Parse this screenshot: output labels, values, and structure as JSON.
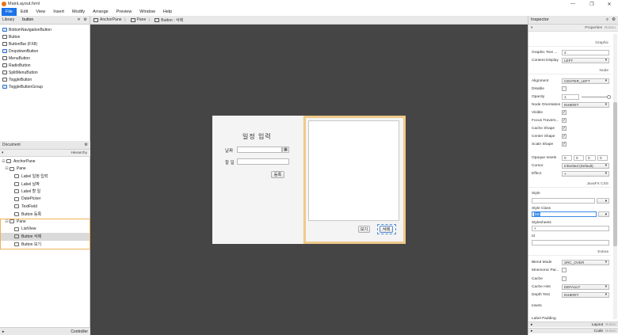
{
  "window": {
    "title": "MainLayout.fxml",
    "minimize": "—",
    "maximize": "❐",
    "close": "✕"
  },
  "menu": [
    "File",
    "Edit",
    "View",
    "Insert",
    "Modify",
    "Arrange",
    "Preview",
    "Window",
    "Help"
  ],
  "library": {
    "title": "Library",
    "search_value": "button",
    "items": [
      "BottomNavigationButton",
      "Button",
      "ButtonBar (FX8)",
      "DropdownButton",
      "MenuButton",
      "RadioButton",
      "SplitMenuButton",
      "ToggleButton",
      "ToggleButtonGroup"
    ]
  },
  "document": {
    "title": "Document",
    "hierarchy_label": "Hierarchy",
    "tree": [
      {
        "label": "AnchorPane",
        "indent": 0,
        "toggle": "⊟"
      },
      {
        "label": "Pane",
        "indent": 1,
        "toggle": "⊟"
      },
      {
        "label": "Label  일정 입력",
        "indent": 2,
        "toggle": ""
      },
      {
        "label": "Label  날짜",
        "indent": 2,
        "toggle": ""
      },
      {
        "label": "Label  할 일",
        "indent": 2,
        "toggle": ""
      },
      {
        "label": "DatePicker",
        "indent": 2,
        "toggle": ""
      },
      {
        "label": "TextField",
        "indent": 2,
        "toggle": ""
      },
      {
        "label": "Button  등록",
        "indent": 2,
        "toggle": ""
      },
      {
        "label": "Pane",
        "indent": 1,
        "toggle": "⊟"
      },
      {
        "label": "ListView",
        "indent": 2,
        "toggle": ""
      },
      {
        "label": "Button  삭제",
        "indent": 2,
        "toggle": ""
      },
      {
        "label": "Button  보기",
        "indent": 2,
        "toggle": ""
      }
    ],
    "controller_label": "Controller"
  },
  "breadcrumb": [
    "AnchorPane",
    "Pane",
    "Button : 삭제"
  ],
  "form": {
    "title": "일정 입력",
    "date_label": "날짜",
    "todo_label": "할 일",
    "register_button": "등록",
    "view_button": "보기",
    "delete_button": "삭제",
    "date_icon": "▦"
  },
  "inspector": {
    "title": "Inspector",
    "properties_label": "Properties",
    "properties_sub": "Button",
    "graphic_section": "Graphic",
    "graphic_text_gap_label": "Graphic Text ...",
    "graphic_text_gap_value": "4",
    "content_display_label": "Content Display",
    "content_display_value": "LEFT",
    "node_section": "Node",
    "alignment_label": "Alignment",
    "alignment_value": "CENTER_LEFT",
    "disable_label": "Disable",
    "opacity_label": "Opacity",
    "opacity_value": "1",
    "node_orientation_label": "Node Orientation",
    "node_orientation_value": "INHERIT",
    "visible_label": "Visible",
    "focus_traversable_label": "Focus Travers...",
    "cache_shape_label": "Cache Shape",
    "center_shape_label": "Center Shape",
    "scale_shape_label": "Scale Shape",
    "opaque_insets_label": "Opaque Insets",
    "opaque_insets_values": [
      "0",
      "0",
      "0",
      "0"
    ],
    "cursor_label": "Cursor",
    "cursor_value": "Inherited (Default)",
    "effect_label": "Effect",
    "effect_value": "+",
    "javafx_css_section": "JavaFX CSS",
    "style_label": "Style",
    "style_class_label": "Style Class",
    "style_class_value": "btn",
    "stylesheets_label": "Stylesheets",
    "stylesheets_value": "+",
    "id_label": "Id",
    "extras_section": "Extras",
    "blend_mode_label": "Blend Mode",
    "blend_mode_value": "SRC_OVER",
    "mnemonic_parsing_label": "Mnemonic Par...",
    "cache_label": "Cache",
    "cache_hint_label": "Cache Hint",
    "cache_hint_value": "DEFAULT",
    "depth_test_label": "Depth Test",
    "depth_test_value": "INHERIT",
    "insets_label": "Insets",
    "label_padding_label": "Label Padding",
    "layout_label": "Layout",
    "layout_sub": "Button",
    "code_label": "Code",
    "code_sub": "Button",
    "check_mark": "✓",
    "combo_arrow": "▾"
  }
}
